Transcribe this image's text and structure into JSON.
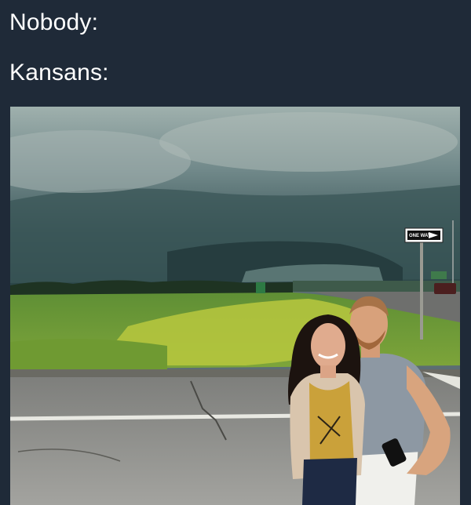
{
  "meme": {
    "line1": "Nobody:",
    "line2": "Kansans:"
  },
  "photo": {
    "scene": "couple-posing-before-tornado",
    "sign_text": "ONE WAY",
    "colors": {
      "background": "#1f2a38",
      "sky": "#6f8584",
      "storm": "#2e4648",
      "grass": "#8dbb3b",
      "road": "#8d8d8a"
    }
  }
}
